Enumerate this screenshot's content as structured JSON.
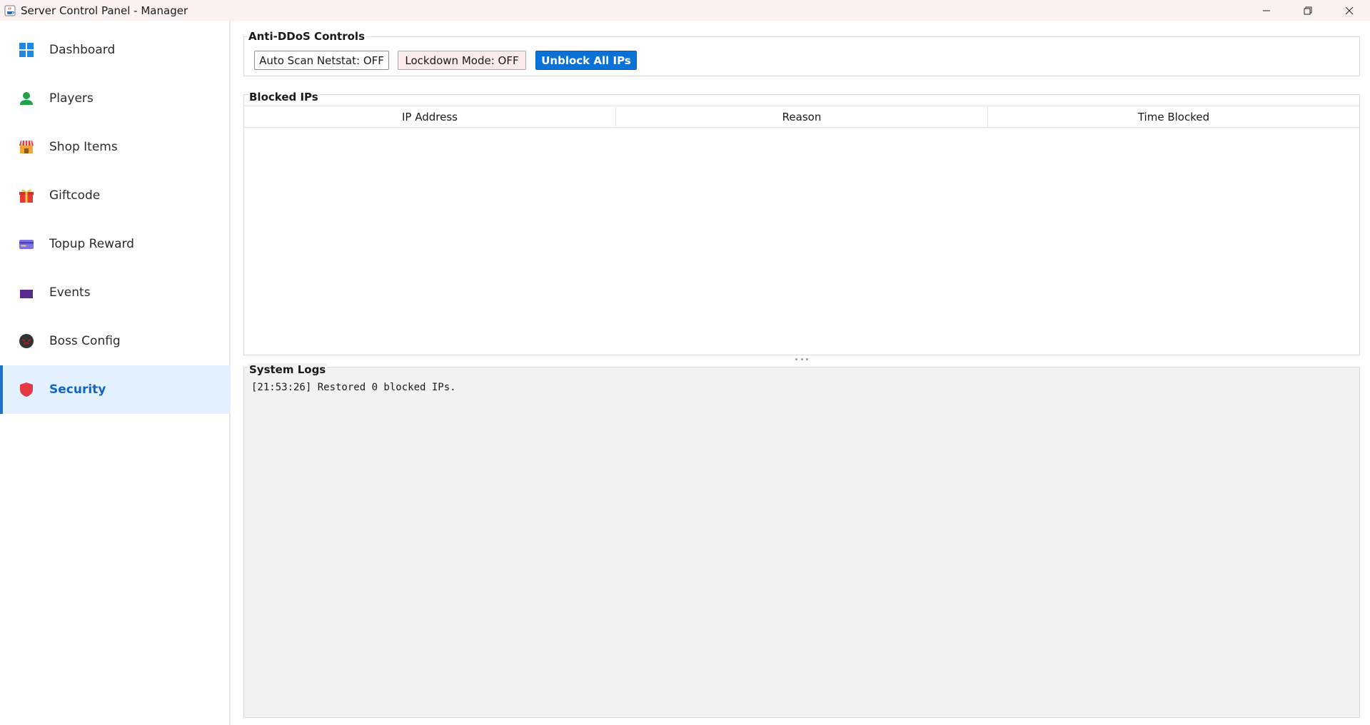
{
  "window": {
    "title": "Server Control Panel - Manager",
    "icon": "java-cup-icon"
  },
  "sidebar": {
    "items": [
      {
        "label": "Dashboard",
        "icon": "grid-icon",
        "color": "#1e88e5",
        "active": false
      },
      {
        "label": "Players",
        "icon": "user-icon",
        "color": "#1fa34a",
        "active": false
      },
      {
        "label": "Shop Items",
        "icon": "store-icon",
        "color": "#f2a33a",
        "active": false
      },
      {
        "label": "Giftcode",
        "icon": "gift-icon",
        "color": "#e53935",
        "active": false
      },
      {
        "label": "Topup Reward",
        "icon": "card-icon",
        "color": "#6c63d9",
        "active": false
      },
      {
        "label": "Events",
        "icon": "events-icon",
        "color": "#5b2a8f",
        "active": false
      },
      {
        "label": "Boss Config",
        "icon": "boss-icon",
        "color": "#333333",
        "active": false
      },
      {
        "label": "Security",
        "icon": "shield-icon",
        "color": "#e53945",
        "active": true
      }
    ]
  },
  "anti_ddos": {
    "title": "Anti-DDoS Controls",
    "auto_scan_label": "Auto Scan Netstat: OFF",
    "lockdown_label": "Lockdown Mode: OFF",
    "unblock_label": "Unblock All IPs"
  },
  "blocked_ips": {
    "title": "Blocked IPs",
    "columns": [
      "IP Address",
      "Reason",
      "Time Blocked"
    ],
    "rows": []
  },
  "system_logs": {
    "title": "System Logs",
    "lines": [
      "[21:53:26] Restored 0 blocked IPs."
    ]
  },
  "colors": {
    "accent": "#1a73c8",
    "primary_button": "#0a72d6",
    "active_nav_bg": "#e3f0fd",
    "titlebar_bg": "#fbf1f2"
  }
}
